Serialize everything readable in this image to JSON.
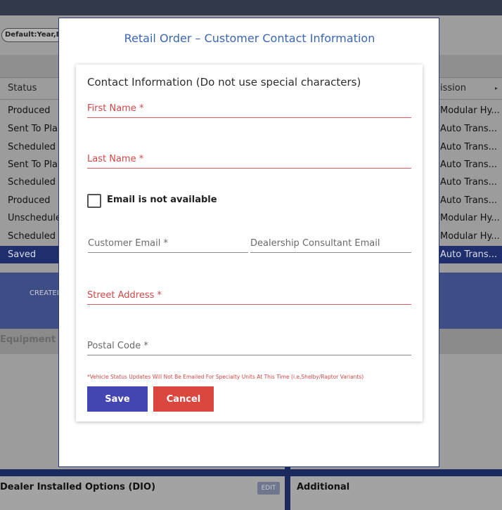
{
  "background": {
    "filter_chip": "Default:Year,B",
    "status_header": "Status",
    "transmission_header": "ission",
    "rows": [
      {
        "status": "Produced",
        "transmission": "Modular Hy..."
      },
      {
        "status": "Sent To Plan",
        "transmission": "Auto Trans..."
      },
      {
        "status": "Scheduled T",
        "transmission": "Auto Trans..."
      },
      {
        "status": "Sent To Plan",
        "transmission": "Auto Trans..."
      },
      {
        "status": "Scheduled T",
        "transmission": "Auto Trans..."
      },
      {
        "status": "Produced",
        "transmission": "Auto Trans..."
      },
      {
        "status": "Unschedule",
        "transmission": "Modular Hy..."
      },
      {
        "status": "Scheduled T",
        "transmission": "Modular Hy..."
      },
      {
        "status": "Saved",
        "transmission": "Auto Trans..."
      }
    ],
    "created_label": "CREATED",
    "equipment_label": "Equipment G",
    "dio_title": "Dealer Installed Options (DIO)",
    "edit_label": "EDIT",
    "additional_title": "Additional"
  },
  "modal": {
    "title": "Retail Order – Customer Contact Information",
    "heading": "Contact Information (Do not use special characters)",
    "fields": {
      "first_name": "First Name *",
      "last_name": "Last Name *",
      "customer_email": "Customer Email *",
      "dealer_email": "Dealership Consultant Email",
      "street_address": "Street Address *",
      "postal_code": "Postal Code *"
    },
    "checkbox_label": "Email is not available",
    "disclaimer": "*Vehicle Status Updates Will Not Be Emailed For Specialty Units At This Time (i.e.Shelby/Raptor Variants)",
    "save_label": "Save",
    "cancel_label": "Cancel"
  },
  "colors": {
    "accent": "#3a66b4",
    "required": "#d04848",
    "save_button": "#4346b0",
    "cancel_button": "#d9473f",
    "selected_row": "#1f2f6e"
  }
}
